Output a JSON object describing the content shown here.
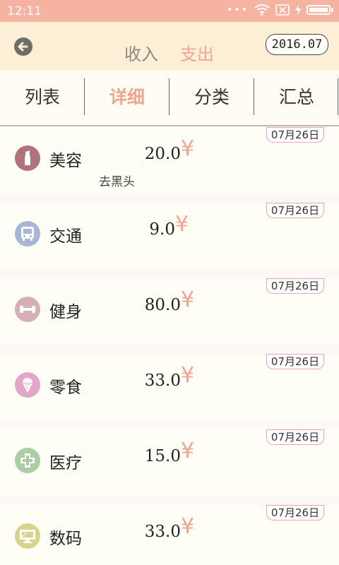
{
  "status": {
    "time": "12:11",
    "dots": "•••"
  },
  "header": {
    "income_label": "收入",
    "expense_label": "支出",
    "date": "2016.07"
  },
  "tabs": [
    "列表",
    "详细",
    "分类",
    "汇总"
  ],
  "active_tab": "详细",
  "records": [
    {
      "date": "07月26日",
      "category": "美容",
      "amount": "20.0",
      "currency": "¥",
      "note": "去黑头",
      "icon": "cosmetics-icon",
      "color": "#b2727a"
    },
    {
      "date": "07月26日",
      "category": "交通",
      "amount": "9.0",
      "currency": "¥",
      "note": "",
      "icon": "bus-icon",
      "color": "#a6b5d8"
    },
    {
      "date": "07月26日",
      "category": "健身",
      "amount": "80.0",
      "currency": "¥",
      "note": "",
      "icon": "dumbbell-icon",
      "color": "#d7aeb3"
    },
    {
      "date": "07月26日",
      "category": "零食",
      "amount": "33.0",
      "currency": "¥",
      "note": "",
      "icon": "icecream-icon",
      "color": "#e3a6c9"
    },
    {
      "date": "07月26日",
      "category": "医疗",
      "amount": "15.0",
      "currency": "¥",
      "note": "",
      "icon": "medical-cross-icon",
      "color": "#a9cea4"
    },
    {
      "date": "07月26日",
      "category": "数码",
      "amount": "33.0",
      "currency": "¥",
      "note": "",
      "icon": "monitor-icon",
      "color": "#d7d48d"
    }
  ],
  "colors": {
    "accent": "#f3a48e",
    "statusbar": "#f7b3a2",
    "header_bg": "#fcefd6"
  }
}
